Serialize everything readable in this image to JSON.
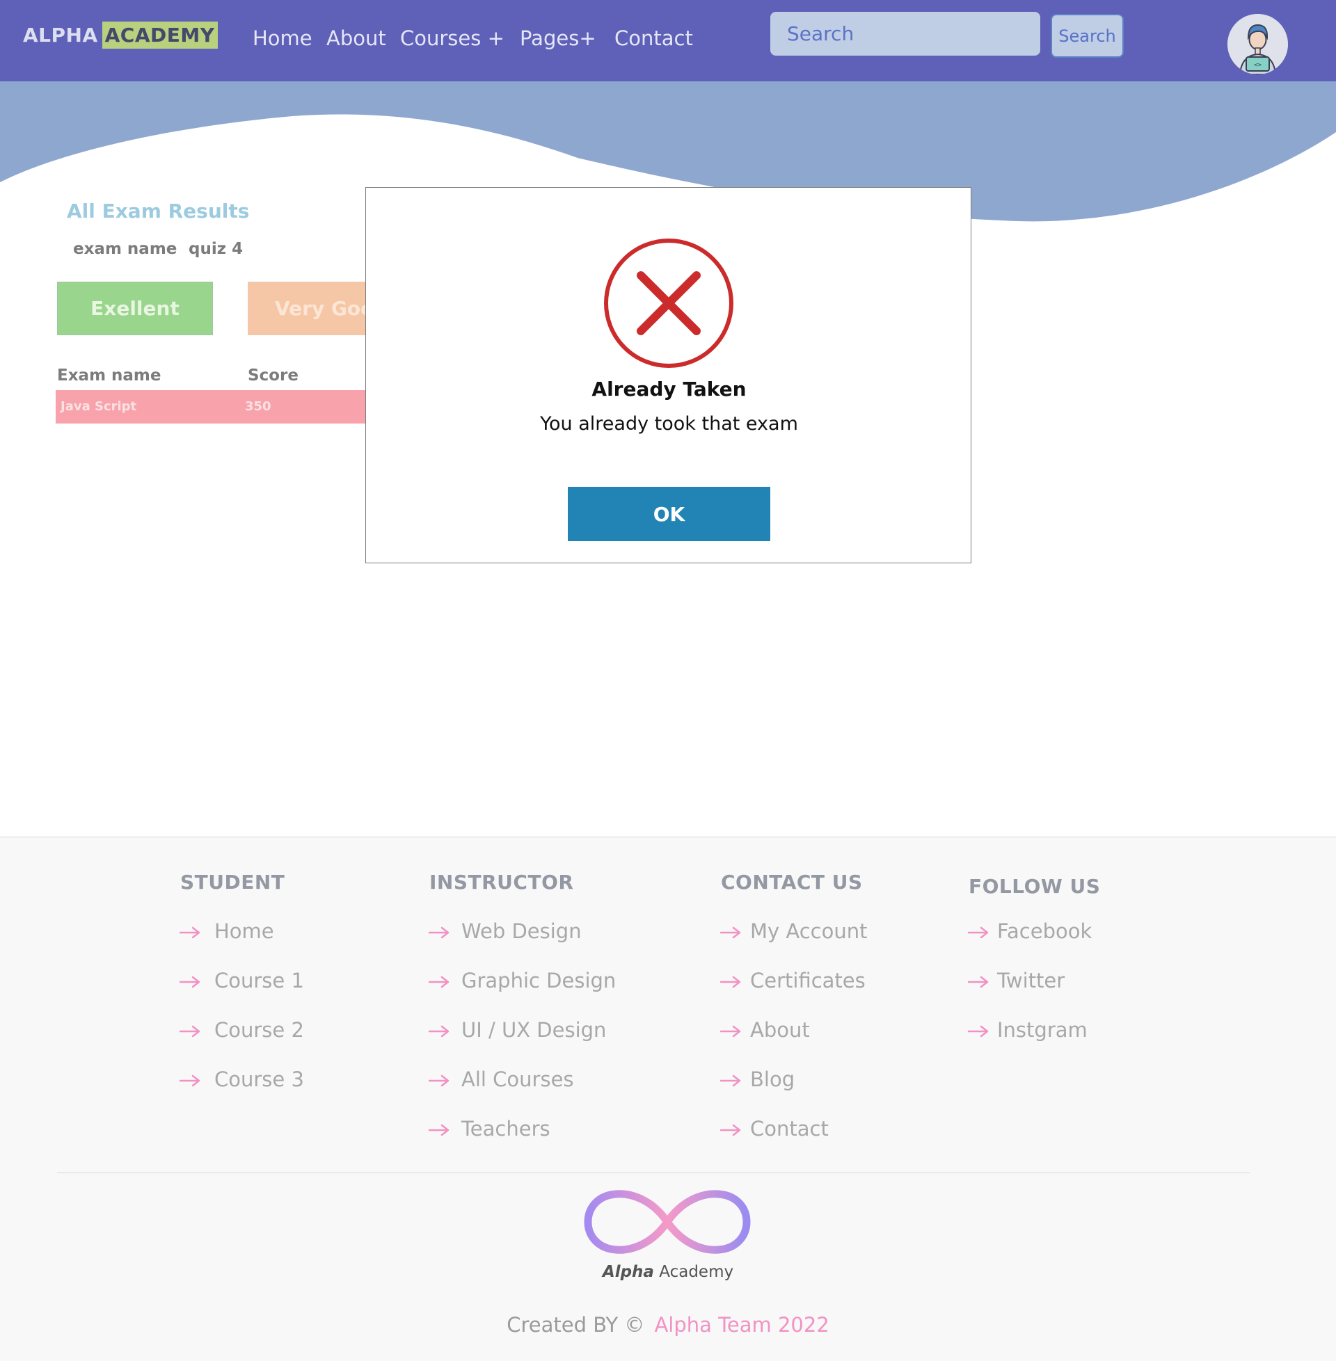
{
  "navbar": {
    "logo_part1": "ALPHA",
    "logo_part2": "ACADEMY",
    "links": [
      "Home",
      "About",
      "Courses +",
      "Pages+",
      "Contact"
    ],
    "search_placeholder": "Search",
    "search_button": "Search"
  },
  "results": {
    "title": "All Exam Results",
    "exam_label": "exam name",
    "exam_value": "quiz 4",
    "grades": [
      "Exellent",
      "Very Good"
    ],
    "table_headers": [
      "Exam name",
      "Score"
    ],
    "rows": [
      {
        "exam": "Java  Script",
        "score": "350"
      }
    ]
  },
  "modal": {
    "icon": "error-x-icon",
    "title": "Already Taken",
    "message": "You already took that exam",
    "ok_button": "OK"
  },
  "footer": {
    "columns": [
      {
        "title": "STUDENT",
        "links": [
          "Home",
          "Course 1",
          "Course 2",
          "Course 3"
        ]
      },
      {
        "title": "INSTRUCTOR",
        "links": [
          "Web Design",
          "Graphic Design",
          "UI / UX Design",
          "All Courses",
          "Teachers"
        ]
      },
      {
        "title": "CONTACT US",
        "links": [
          "My Account",
          "Certificates",
          "About",
          "Blog",
          "Contact"
        ]
      },
      {
        "title": "FOLLOW US",
        "links": [
          "Facebook",
          "Twitter",
          "Instgram"
        ]
      }
    ],
    "logo_text_bold": "Alpha",
    "logo_text": "Academy",
    "credit_prefix": "Created BY ©",
    "credit_team": "Alpha Team 2022"
  },
  "colors": {
    "navbar": "#5f60b8",
    "wave": "#8ea7cf",
    "accent_pink": "#f292c4",
    "ok_button": "#2284b4",
    "error_red": "#cc2b2b"
  }
}
